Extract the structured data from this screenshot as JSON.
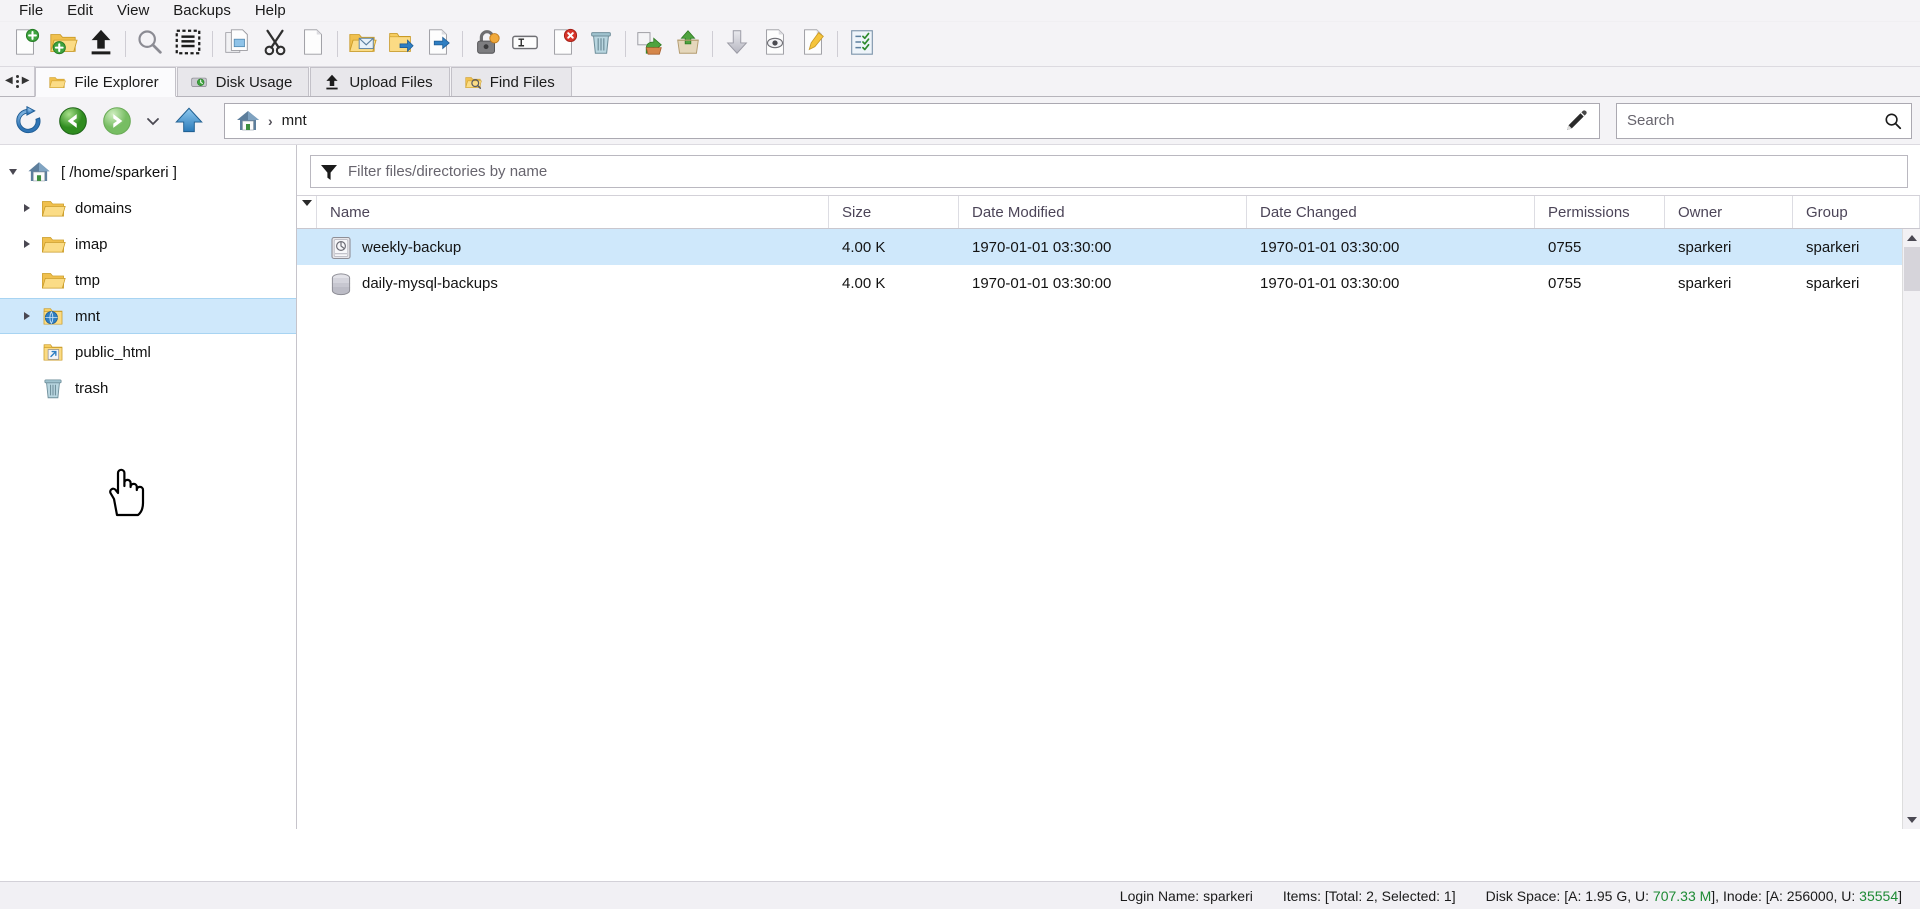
{
  "menubar": {
    "items": [
      {
        "label": "File",
        "name": "menu-file"
      },
      {
        "label": "Edit",
        "name": "menu-edit"
      },
      {
        "label": "View",
        "name": "menu-view"
      },
      {
        "label": "Backups",
        "name": "menu-backups"
      },
      {
        "label": "Help",
        "name": "menu-help"
      }
    ]
  },
  "toolbar": {
    "buttons": [
      {
        "icon": "new-file-icon",
        "label": "New File"
      },
      {
        "icon": "new-folder-icon",
        "label": "New Folder"
      },
      {
        "icon": "upload-icon",
        "label": "Upload"
      },
      {
        "sep": true
      },
      {
        "icon": "search-icon",
        "label": "Search"
      },
      {
        "icon": "select-all-icon",
        "label": "Select All"
      },
      {
        "sep": true
      },
      {
        "icon": "copy-icon",
        "label": "Copy"
      },
      {
        "icon": "cut-icon",
        "label": "Cut"
      },
      {
        "icon": "paste-icon",
        "label": "Paste"
      },
      {
        "sep": true
      },
      {
        "icon": "open-folder-mail-icon",
        "label": "Open"
      },
      {
        "icon": "move-folder-icon",
        "label": "Move"
      },
      {
        "icon": "rename-file-icon",
        "label": "Rename"
      },
      {
        "sep": true
      },
      {
        "icon": "permissions-lock-icon",
        "label": "Permissions"
      },
      {
        "icon": "text-field-icon",
        "label": "Edit Name"
      },
      {
        "icon": "delete-file-icon",
        "label": "Delete File"
      },
      {
        "icon": "trash-icon",
        "label": "Trash"
      },
      {
        "sep": true
      },
      {
        "icon": "extract-icon",
        "label": "Extract"
      },
      {
        "icon": "compress-icon",
        "label": "Compress"
      },
      {
        "sep": true
      },
      {
        "icon": "download-icon",
        "label": "Download"
      },
      {
        "icon": "view-file-icon",
        "label": "View"
      },
      {
        "icon": "edit-file-icon",
        "label": "Edit"
      },
      {
        "sep": true
      },
      {
        "icon": "checklist-icon",
        "label": "Tasks"
      }
    ]
  },
  "tabs": [
    {
      "label": "File Explorer",
      "icon": "folder-icon",
      "active": true,
      "name": "tab-file-explorer"
    },
    {
      "label": "Disk Usage",
      "icon": "disk-usage-icon",
      "active": false,
      "name": "tab-disk-usage"
    },
    {
      "label": "Upload Files",
      "icon": "upload-icon",
      "active": false,
      "name": "tab-upload-files"
    },
    {
      "label": "Find Files",
      "icon": "find-files-icon",
      "active": false,
      "name": "tab-find-files"
    }
  ],
  "nav": {
    "refresh_label": "Refresh",
    "back_label": "Back",
    "forward_label": "Forward",
    "history_label": "History",
    "up_label": "Up One Level",
    "breadcrumb": {
      "home_icon": "home-icon",
      "separator": "›",
      "current": "mnt"
    },
    "edit_path_icon": "pencil-icon"
  },
  "search": {
    "placeholder": "Search",
    "value": "",
    "icon": "search-icon"
  },
  "filter": {
    "placeholder": "Filter files/directories by name",
    "value": "",
    "icon": "funnel-icon"
  },
  "sidebar": {
    "items": [
      {
        "label": "[ /home/sparkeri ]",
        "icon": "home-icon",
        "twisty": "down",
        "depth": 0,
        "selected": false,
        "name": "tree-item-home"
      },
      {
        "label": "domains",
        "icon": "folder-icon",
        "twisty": "right",
        "depth": 1,
        "selected": false,
        "name": "tree-item-domains"
      },
      {
        "label": "imap",
        "icon": "folder-icon",
        "twisty": "right",
        "depth": 1,
        "selected": false,
        "name": "tree-item-imap"
      },
      {
        "label": "tmp",
        "icon": "folder-icon",
        "twisty": "none",
        "depth": 1,
        "selected": false,
        "name": "tree-item-tmp"
      },
      {
        "label": "mnt",
        "icon": "folder-globe-icon",
        "twisty": "right",
        "depth": 1,
        "selected": true,
        "name": "tree-item-mnt"
      },
      {
        "label": "public_html",
        "icon": "folder-link-icon",
        "twisty": "none",
        "depth": 1,
        "selected": false,
        "name": "tree-item-public-html"
      },
      {
        "label": "trash",
        "icon": "trash-icon",
        "twisty": "none",
        "depth": 1,
        "selected": false,
        "name": "tree-item-trash"
      }
    ]
  },
  "table": {
    "columns": [
      {
        "key": "name",
        "label": "Name"
      },
      {
        "key": "size",
        "label": "Size"
      },
      {
        "key": "date_modified",
        "label": "Date Modified"
      },
      {
        "key": "date_changed",
        "label": "Date Changed"
      },
      {
        "key": "permissions",
        "label": "Permissions"
      },
      {
        "key": "owner",
        "label": "Owner"
      },
      {
        "key": "group",
        "label": "Group"
      }
    ],
    "rows": [
      {
        "name": "weekly-backup",
        "icon": "hard-drive-icon",
        "size": "4.00 K",
        "date_modified": "1970-01-01 03:30:00",
        "date_changed": "1970-01-01 03:30:00",
        "permissions": "0755",
        "owner": "sparkeri",
        "group": "sparkeri",
        "selected": true
      },
      {
        "name": "daily-mysql-backups",
        "icon": "disk-stack-icon",
        "size": "4.00 K",
        "date_modified": "1970-01-01 03:30:00",
        "date_changed": "1970-01-01 03:30:00",
        "permissions": "0755",
        "owner": "sparkeri",
        "group": "sparkeri",
        "selected": false
      }
    ]
  },
  "statusbar": {
    "login": "Login Name: sparkeri",
    "items": "Items: [Total: 2, Selected: 1]",
    "disk_prefix": "Disk Space: [A: 1.95 G, U: ",
    "disk_used": "707.33 M",
    "disk_mid": "], Inode: [A: 256000, U: ",
    "inode_used": "35554",
    "disk_suffix": "]"
  },
  "colors": {
    "selection": "#cfe8fb",
    "chrome": "#f4f3f6",
    "green_text": "#1d8a34"
  }
}
